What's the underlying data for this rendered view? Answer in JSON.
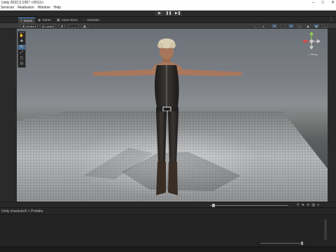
{
  "window": {
    "title": "Unity 2022.3.13f1* <DX11>"
  },
  "menu": [
    "Services",
    "Realtusion",
    "Window",
    "Help"
  ],
  "tabs": [
    {
      "label": "Scene",
      "icon": "scene-icon"
    },
    {
      "label": "Game",
      "icon": "game-icon"
    },
    {
      "label": "Asset Store",
      "icon": "asset-store-icon"
    },
    {
      "label": "Animator",
      "icon": "animator-icon"
    }
  ],
  "scene_toolbar": {
    "pivot_label": "Center",
    "space_label": "Local",
    "grid_label": "⊞"
  },
  "gizmo": {
    "projection_label": "< Persp"
  },
  "path": {
    "breadcrumb": "Unity character5 > Prefabs"
  },
  "colors": {
    "accent": "#4a90d9",
    "viewport_sky": "#7c8086",
    "floor": "#b9bcbe"
  }
}
